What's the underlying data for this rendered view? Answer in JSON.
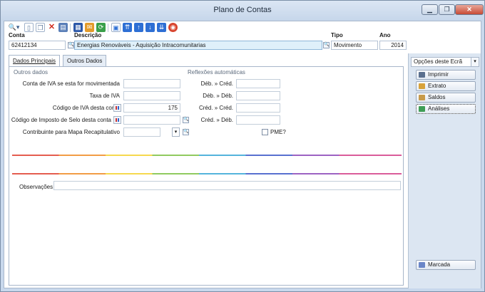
{
  "window": {
    "title": "Plano de Contas",
    "minimize_label": "▁",
    "restore_label": "❐",
    "close_label": "✕"
  },
  "header": {
    "conta_label": "Conta",
    "conta_value": "62412134",
    "descricao_label": "Descrição",
    "descricao_value": "Energias Renováveis - Aquisição Intracomunitarias",
    "tipo_label": "Tipo",
    "tipo_value": "Movimento",
    "ano_label": "Ano",
    "ano_value": "2014"
  },
  "tabs": [
    {
      "label": "Dados Principais"
    },
    {
      "label": "Outros Dados"
    }
  ],
  "dados": {
    "outros_title": "Outros dados",
    "reflexoes_title": "Reflexões automáticas",
    "conta_iva_label": "Conta de IVA se esta for movimentada",
    "conta_iva_value": "",
    "taxa_iva_label": "Taxa de IVA",
    "taxa_iva_value": "",
    "codigo_iva_label": "Código de IVA desta conta",
    "codigo_iva_value": "175",
    "codigo_selo_label": "Código de Imposto de Selo desta conta",
    "codigo_selo_value": "",
    "contribuinte_label": "Contribuinte para Mapa Recapitulativo",
    "contribuinte_value": "",
    "deb_cred_label": "Déb. » Créd.",
    "deb_deb_label": "Déb. » Déb.",
    "cred_cred_label": "Créd. » Créd.",
    "cred_deb_label": "Créd. » Déb.",
    "pme_label": "PME?",
    "observacoes_label": "Observações",
    "observacoes_value": ""
  },
  "options": {
    "title": "Opções deste Ecrã",
    "buttons": [
      {
        "label": "Imprimir",
        "color": "#5a6f8e"
      },
      {
        "label": "Extrato",
        "color": "#d8a23a"
      },
      {
        "label": "Saldos",
        "color": "#c79a4a"
      },
      {
        "label": "Análises",
        "color": "#3e9e55"
      }
    ],
    "marcada_label": "Marcada"
  },
  "toolbar": {
    "icons": [
      "search-icon",
      "new-icon",
      "copy-icon",
      "delete-icon",
      "properties-icon",
      "table-icon",
      "open-icon",
      "refresh-icon",
      "preview-icon",
      "first-icon",
      "previous-icon",
      "next-icon",
      "last-icon",
      "help-icon"
    ]
  }
}
